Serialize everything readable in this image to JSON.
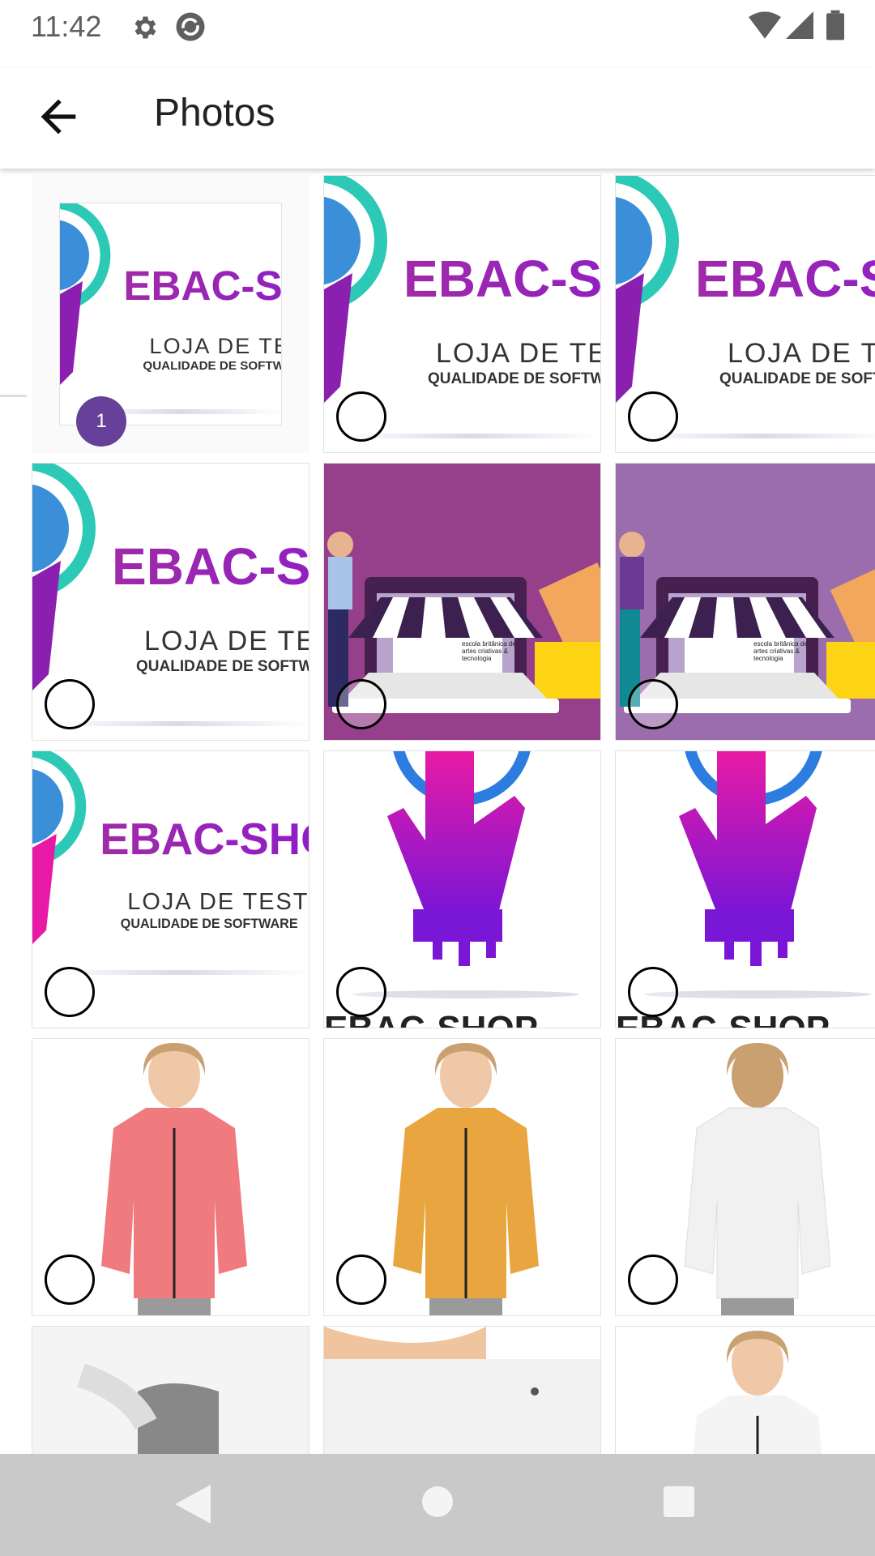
{
  "status_bar": {
    "time": "11:42",
    "icons": [
      "settings-icon",
      "sync-icon",
      "wifi-icon",
      "signal-icon",
      "battery-icon"
    ]
  },
  "app_bar": {
    "title": "Photos",
    "back_icon": "arrow-back-icon"
  },
  "selection": {
    "count": "1"
  },
  "image_text": {
    "logo_title": "EBAC-SHOP",
    "logo_sub": "LOJA DE TESTES",
    "logo_sub2": "QUALIDADE DE SOFTWARE",
    "store_brand": "escola britânica de artes criativas & tecnologia"
  },
  "photos": [
    {
      "type": "logo",
      "selected": true
    },
    {
      "type": "logo",
      "selected": false
    },
    {
      "type": "logo",
      "selected": false
    },
    {
      "type": "logo",
      "selected": false
    },
    {
      "type": "store",
      "selected": false,
      "bg": "#96408c"
    },
    {
      "type": "store",
      "selected": false,
      "bg": "#9c6dac"
    },
    {
      "type": "logo2",
      "selected": false
    },
    {
      "type": "hand",
      "selected": false
    },
    {
      "type": "hand",
      "selected": false
    },
    {
      "type": "jacket",
      "selected": false,
      "color": "#ef7b7f"
    },
    {
      "type": "jacket",
      "selected": false,
      "color": "#e8a540"
    },
    {
      "type": "jacket-back",
      "selected": false,
      "color": "#f1f1f1"
    },
    {
      "type": "closeup",
      "selected": false
    },
    {
      "type": "closeup",
      "selected": false
    },
    {
      "type": "jacket",
      "selected": false,
      "color": "#f4f4f4"
    }
  ],
  "nav_bar": {
    "icons": [
      "back-triangle-icon",
      "home-circle-icon",
      "recents-square-icon"
    ]
  }
}
